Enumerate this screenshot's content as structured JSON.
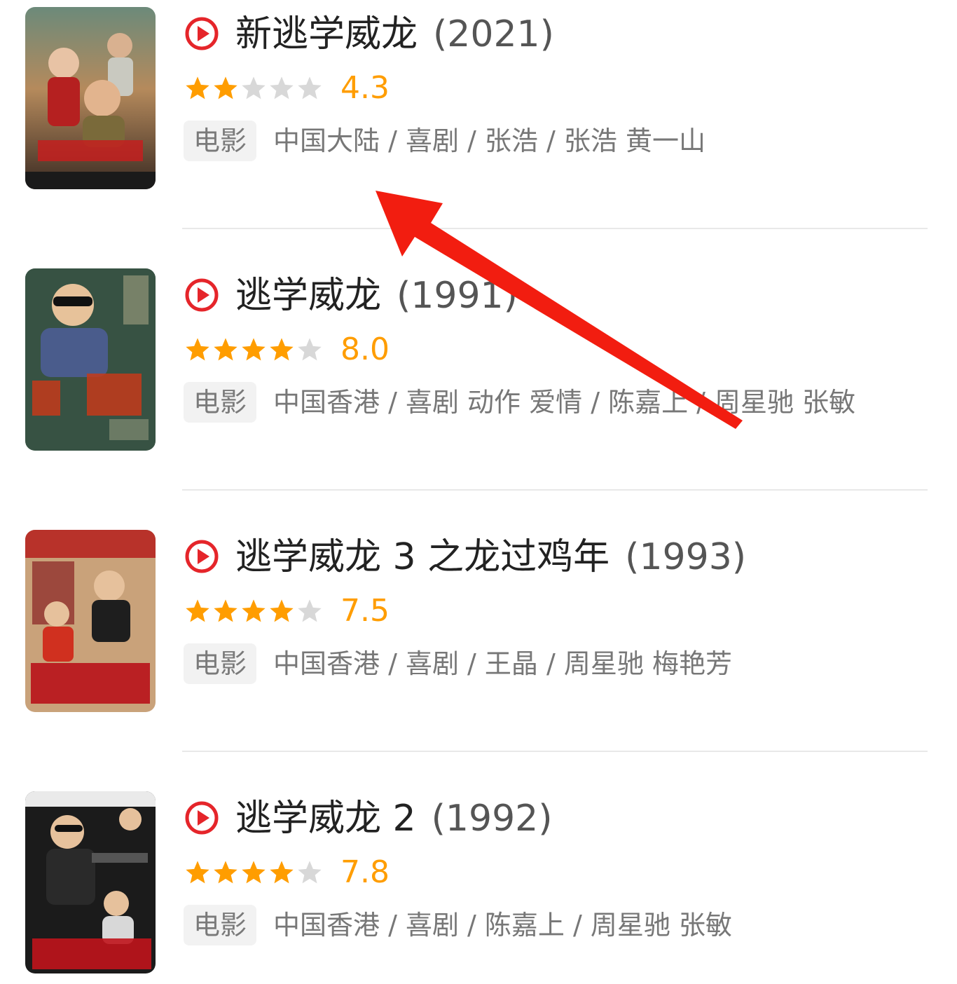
{
  "colors": {
    "accent": "#e5252a",
    "star_filled": "#ff9d00",
    "star_empty": "#d8d8d8",
    "rating_text": "#ff9d00",
    "annotation_arrow": "#f21d10"
  },
  "items": [
    {
      "title": "新逃学威龙",
      "year": "(2021)",
      "stars_filled": 2,
      "stars_total": 5,
      "rating": "4.3",
      "tag": "电影",
      "meta": "中国大陆 / 喜剧 / 张浩 / 张浩 黄一山",
      "poster_icon": "movie-poster-image"
    },
    {
      "title": "逃学威龙",
      "year": "(1991)",
      "stars_filled": 4,
      "stars_total": 5,
      "rating": "8.0",
      "tag": "电影",
      "meta": "中国香港 / 喜剧 动作 爱情 / 陈嘉上 / 周星驰 张敏",
      "poster_icon": "movie-poster-image"
    },
    {
      "title": "逃学威龙 3 之龙过鸡年",
      "year": "(1993)",
      "stars_filled": 4,
      "stars_total": 5,
      "rating": "7.5",
      "tag": "电影",
      "meta": "中国香港 / 喜剧 / 王晶 / 周星驰 梅艳芳",
      "poster_icon": "movie-poster-image"
    },
    {
      "title": "逃学威龙 2",
      "year": "(1992)",
      "stars_filled": 4,
      "stars_total": 5,
      "rating": "7.8",
      "tag": "电影",
      "meta": "中国香港 / 喜剧 / 陈嘉上 / 周星驰 张敏",
      "poster_icon": "movie-poster-image"
    }
  ],
  "icons": {
    "play": "play-circle-icon",
    "star": "star-icon",
    "annotation": "red-arrow-annotation"
  }
}
